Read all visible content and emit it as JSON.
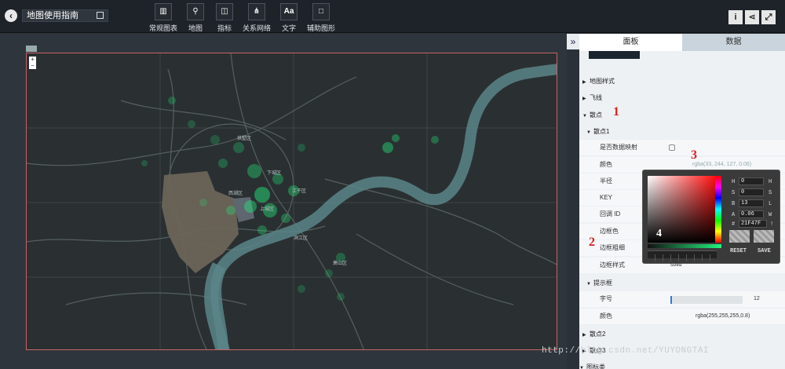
{
  "app": {
    "title": "地图使用指南",
    "back_icon": "chevron-left-icon"
  },
  "toolbar": {
    "items": [
      {
        "label": "常规图表",
        "icon": "bar-chart-icon",
        "glyph": "📊"
      },
      {
        "label": "地图",
        "icon": "map-pin-icon",
        "glyph": "⚲"
      },
      {
        "label": "指标",
        "icon": "indicator-icon",
        "glyph": "◫"
      },
      {
        "label": "关系网络",
        "icon": "network-icon",
        "glyph": "⋔"
      },
      {
        "label": "文字",
        "icon": "text-icon",
        "glyph": "Aa"
      },
      {
        "label": "辅助图形",
        "icon": "shape-icon",
        "glyph": "□"
      }
    ],
    "right_icons": [
      {
        "name": "info-icon",
        "glyph": "i"
      },
      {
        "name": "share-icon",
        "glyph": "<"
      },
      {
        "name": "fullscreen-icon",
        "glyph": "⤢"
      }
    ]
  },
  "map": {
    "places": [
      "拱墅区",
      "下城区",
      "西湖区",
      "上城区",
      "江干区",
      "滨江区",
      "萧山区"
    ]
  },
  "panel": {
    "collapse_glyph": "»",
    "tabs": [
      "面板",
      "数据"
    ],
    "sections": {
      "map_style": "地图样式",
      "flyline": "飞线",
      "scatter": "散点",
      "scatter1": "散点1",
      "tooltip": "提示框",
      "scatter2": "散点2",
      "scatter3": "散点3",
      "icon_class": "图标类"
    },
    "rows": {
      "data_mapping": "是否数据映射",
      "color": "颜色",
      "color_value": "rgba(33, 244, 127, 0.06)",
      "radius": "半径",
      "key": "KEY",
      "callback_id": "回调 ID",
      "border_color": "边框色",
      "border_width": "边框粗细",
      "border_style": "边框样式",
      "border_style_value": "solid",
      "font_size": "字号",
      "font_size_value": "12",
      "tip_color": "颜色",
      "tip_color_value": "rgba(255,255,255,0.8)"
    }
  },
  "picker": {
    "H": "0",
    "S": "0",
    "B": "13",
    "A": "0.06",
    "hex": "21F47F",
    "labels": {
      "H": "H",
      "S": "S",
      "B": "B",
      "A": "A",
      "hash": "#"
    },
    "right_labels": [
      "H",
      "S",
      "L",
      "W",
      "!"
    ],
    "reset": "RESET",
    "save": "SAVE",
    "accent": "#21f47f"
  },
  "annotations": {
    "m1": "1",
    "m2": "2",
    "m3": "3",
    "m4": "4"
  },
  "watermark": "http://blog.csdn.net/YUYONGTAI"
}
